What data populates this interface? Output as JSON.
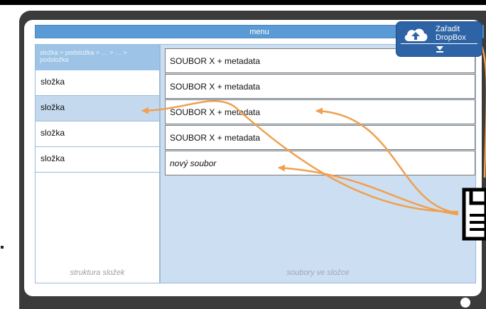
{
  "menu": {
    "label": "menu"
  },
  "sidebar": {
    "breadcrumb": "složka > podsložka > … > … > podsložka",
    "folders": [
      "složka",
      "složka",
      "složka",
      "složka"
    ],
    "selected_index": 1,
    "caption": "struktura složek"
  },
  "files": {
    "items": [
      "SOUBOR X + metadata",
      "SOUBOR X + metadata",
      "SOUBOR X + metadata",
      "SOUBOR X + metadata",
      "nový soubor"
    ],
    "caption": "soubory ve složce"
  },
  "dropbox": {
    "line1": "Zařadit",
    "line2": "DropBox"
  },
  "icons": {
    "upload": "cloud-upload-icon",
    "expand": "chevron-down-icon",
    "document": "document-icon"
  },
  "colors": {
    "accent": "#5b9bd5",
    "arrow": "#f0a050",
    "dropbox": "#2e64a6",
    "files_bg": "#ccdff2"
  }
}
